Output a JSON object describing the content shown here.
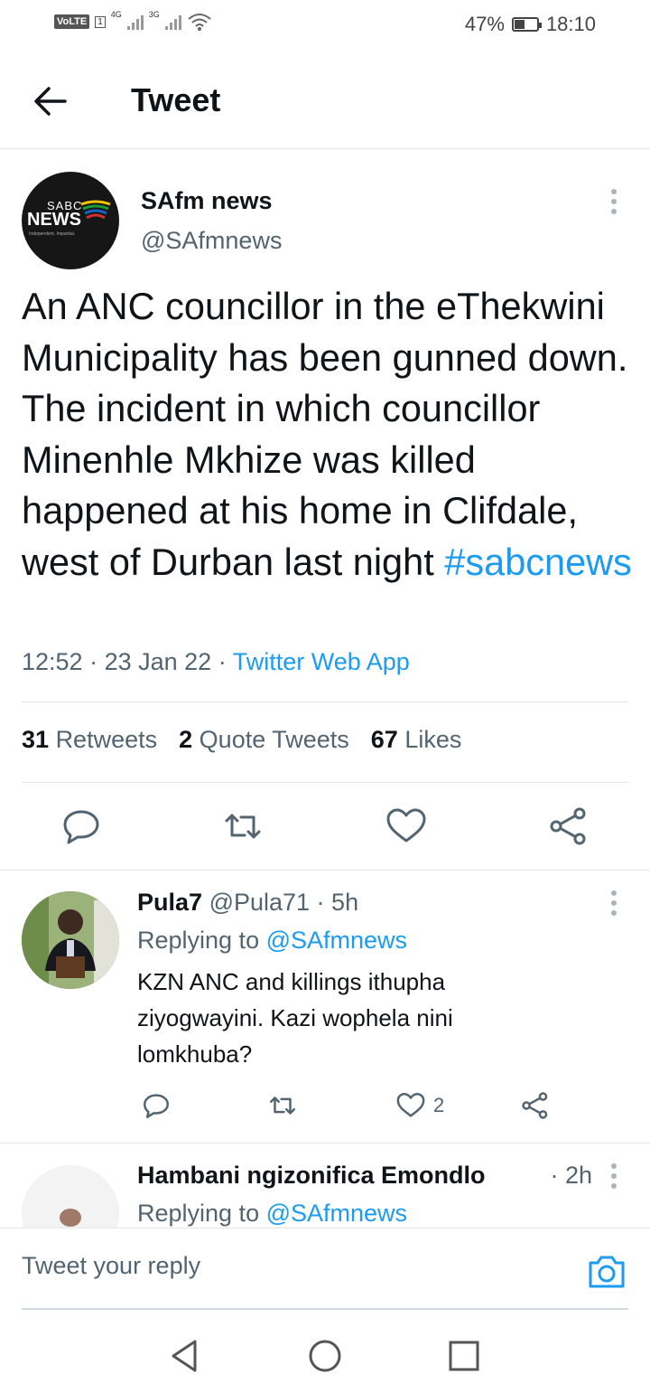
{
  "status_bar": {
    "volte": "VoLTE",
    "sim_slot": "1",
    "net1": "4G",
    "net2": "3G",
    "battery": "47%",
    "battery_level": 0.47,
    "time": "18:10"
  },
  "header": {
    "title": "Tweet",
    "back_icon": "arrow-left-icon"
  },
  "tweet": {
    "avatar_text_top": "SABC",
    "avatar_text_main": "NEWS",
    "avatar_tagline": "Independent. Impartial.",
    "author_name": "SAfm news",
    "author_handle": "@SAfmnews",
    "text": "An ANC councillor in the eThekwini Municipality has been gunned down. The incident in which councillor Minenhle Mkhize was killed happened at his home in Clifdale, west of Durban last night ",
    "hashtag": "#sabcnews",
    "time": "12:52",
    "date": "23 Jan 22",
    "source": "Twitter Web App",
    "stats": {
      "retweets_count": "31",
      "retweets_label": "Retweets",
      "quotes_count": "2",
      "quotes_label": "Quote Tweets",
      "likes_count": "67",
      "likes_label": "Likes"
    },
    "actions": [
      "reply-icon",
      "retweet-icon",
      "like-icon",
      "share-icon"
    ]
  },
  "replies": [
    {
      "name": "Pula7",
      "handle": "@Pula71",
      "time": "5h",
      "replying_label": "Replying to ",
      "replying_to": "@SAfmnews",
      "text": "KZN ANC and killings ithupha ziyogwayini. Kazi wophela nini lomkhuba?",
      "likes": "2"
    },
    {
      "name": "Hambani ngizonifica Emondlo",
      "time": "2h",
      "replying_label": "Replying to ",
      "replying_to": "@SAfmnews"
    }
  ],
  "composer": {
    "placeholder": "Tweet your reply",
    "camera_icon": "camera-icon"
  },
  "nav": [
    "back-triangle-icon",
    "home-circle-icon",
    "recents-square-icon"
  ],
  "colors": {
    "accent": "#1d9bf0",
    "secondary_text": "#536471",
    "primary_text": "#0f1419",
    "divider": "#e6e6e6"
  }
}
